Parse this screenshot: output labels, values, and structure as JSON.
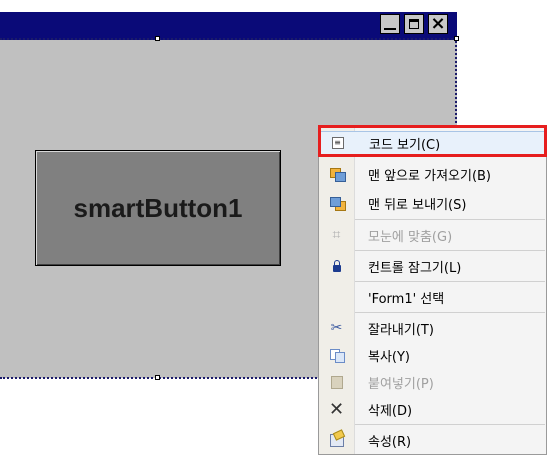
{
  "form": {
    "window_buttons": {
      "minimize": "minimize-icon",
      "maximize": "maximize-icon",
      "close": "×"
    },
    "control": {
      "label": "smartButton1"
    }
  },
  "context_menu": {
    "items": [
      {
        "label": "코드 보기(C)",
        "icon": "view-code-icon",
        "disabled": false,
        "highlighted": true
      },
      {
        "label": "맨 앞으로 가져오기(B)",
        "icon": "bring-to-front-icon",
        "disabled": false
      },
      {
        "label": "맨 뒤로 보내기(S)",
        "icon": "send-to-back-icon",
        "disabled": false
      },
      {
        "label": "모눈에 맞춤(G)",
        "icon": "align-to-grid-icon",
        "disabled": true
      },
      {
        "label": "컨트롤 잠그기(L)",
        "icon": "lock-icon",
        "disabled": false
      },
      {
        "label": "'Form1' 선택",
        "icon": "",
        "disabled": false
      },
      {
        "label": "잘라내기(T)",
        "icon": "cut-icon",
        "disabled": false
      },
      {
        "label": "복사(Y)",
        "icon": "copy-icon",
        "disabled": false
      },
      {
        "label": "붙여넣기(P)",
        "icon": "paste-icon",
        "disabled": true
      },
      {
        "label": "삭제(D)",
        "icon": "delete-icon",
        "disabled": false
      },
      {
        "label": "속성(R)",
        "icon": "properties-icon",
        "disabled": false
      }
    ]
  },
  "colors": {
    "titlebar": "#0a0a78",
    "form_background": "#c0c0c0",
    "button_face": "#808080",
    "highlight_border": "#e61e1e"
  }
}
